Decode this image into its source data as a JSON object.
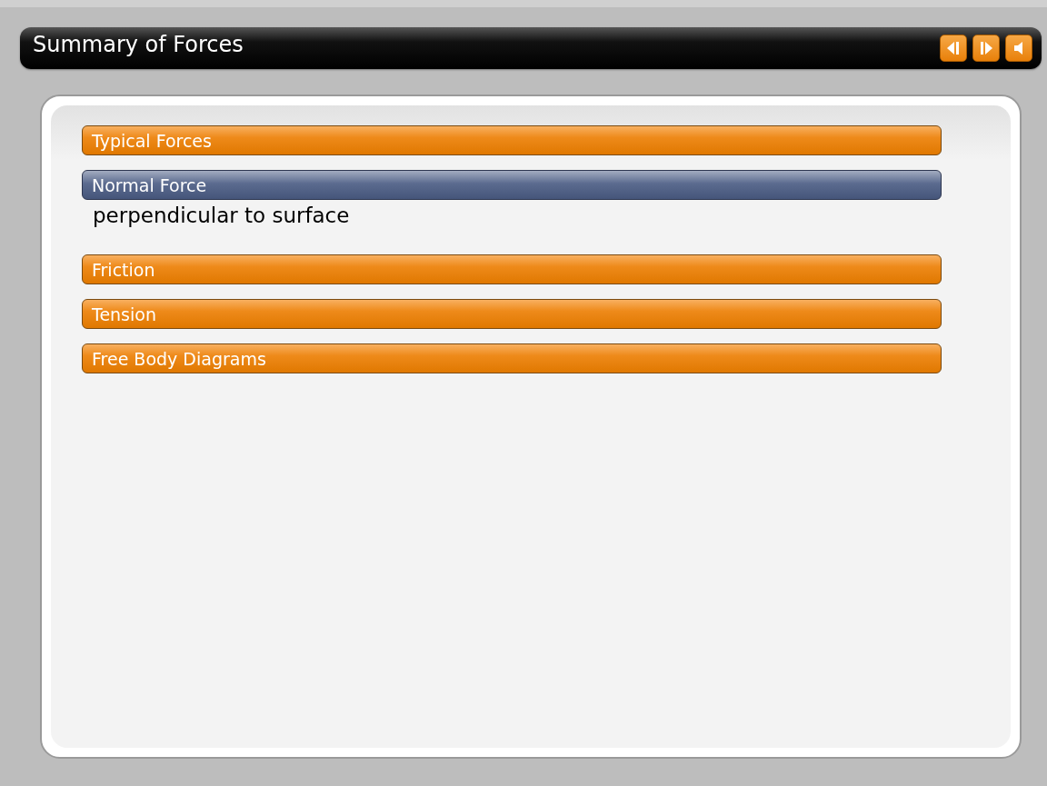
{
  "window": {
    "title": "Summary of Forces"
  },
  "nav_buttons": [
    {
      "kind": "previous"
    },
    {
      "kind": "next"
    },
    {
      "kind": "audio"
    }
  ],
  "sections": [
    {
      "label": "Typical Forces",
      "selected": false
    },
    {
      "label": "Normal Force",
      "selected": true,
      "detail": "perpendicular to surface"
    },
    {
      "label": "Friction",
      "selected": false
    },
    {
      "label": "Tension",
      "selected": false
    },
    {
      "label": "Free Body Diagrams",
      "selected": false
    }
  ]
}
